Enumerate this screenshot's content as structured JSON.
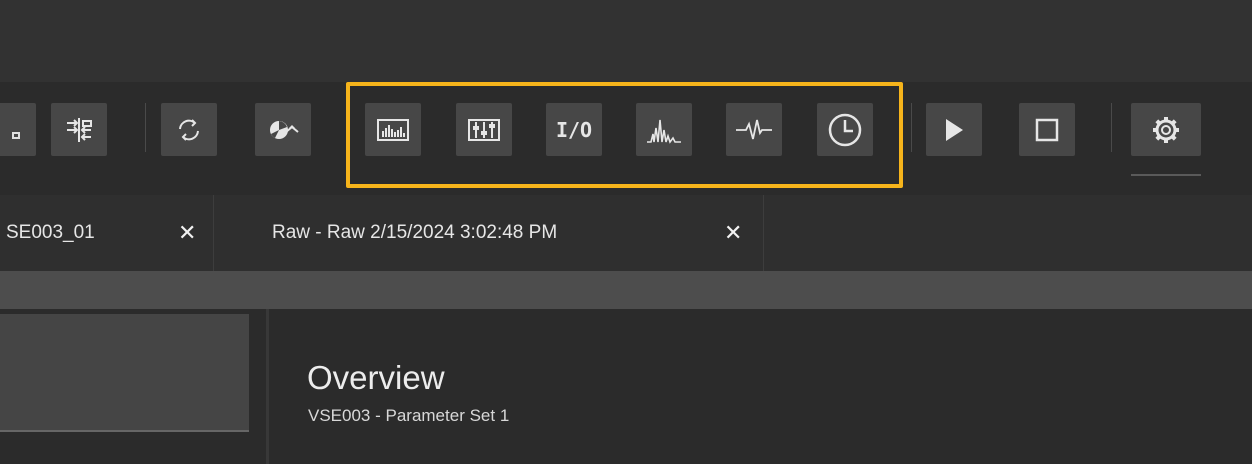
{
  "toolbar": {
    "buttons": [
      {
        "icon": "partial-button-icon"
      },
      {
        "icon": "input-output-arrows-icon"
      },
      {
        "icon": "refresh-icon"
      },
      {
        "icon": "pie-undo-icon"
      },
      {
        "icon": "bar-chart-icon"
      },
      {
        "icon": "slider-panel-icon"
      },
      {
        "icon": "io-icon",
        "label": "I/O"
      },
      {
        "icon": "spectrum-icon"
      },
      {
        "icon": "waveform-icon"
      },
      {
        "icon": "clock-icon"
      },
      {
        "icon": "play-icon"
      },
      {
        "icon": "stop-icon"
      },
      {
        "icon": "gear-icon"
      }
    ],
    "highlight_color": "#f6b41b"
  },
  "tabs": [
    {
      "label": "SE003_01",
      "close": "✕"
    },
    {
      "label": "Raw - Raw 2/15/2024 3:02:48 PM",
      "close": "✕"
    }
  ],
  "overview": {
    "title": "Overview",
    "subtitle": "VSE003 - Parameter Set 1"
  }
}
